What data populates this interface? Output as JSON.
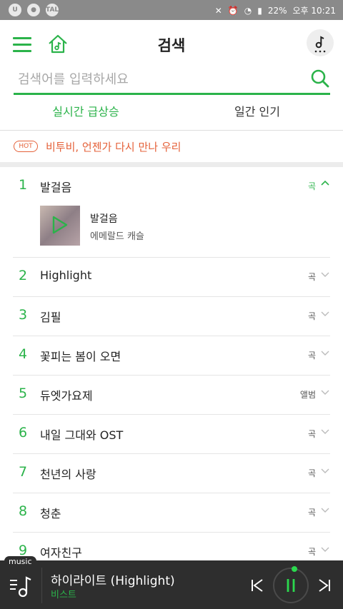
{
  "statusbar": {
    "icons": [
      "u-plus-icon",
      "chat-icon",
      "talk-icon"
    ],
    "battery": "22%",
    "time": "오후 10:21"
  },
  "header": {
    "title": "검색"
  },
  "search": {
    "placeholder": "검색어를 입력하세요",
    "value": ""
  },
  "tabs": [
    {
      "label": "실시간 급상승",
      "active": true
    },
    {
      "label": "일간 인기",
      "active": false
    }
  ],
  "hot": {
    "badge": "HOT",
    "text": "비투비, 언젠가 다시 만나 우리"
  },
  "ranking": [
    {
      "rank": "1",
      "keyword": "발걸음",
      "category": "곡",
      "expanded": true,
      "detail": {
        "title": "발걸음",
        "artist": "에메랄드 캐슬"
      }
    },
    {
      "rank": "2",
      "keyword": "Highlight",
      "category": "곡"
    },
    {
      "rank": "3",
      "keyword": "김필",
      "category": "곡"
    },
    {
      "rank": "4",
      "keyword": "꽃피는 봄이 오면",
      "category": "곡"
    },
    {
      "rank": "5",
      "keyword": "듀엣가요제",
      "category": "앨범"
    },
    {
      "rank": "6",
      "keyword": "내일 그대와 OST",
      "category": "곡"
    },
    {
      "rank": "7",
      "keyword": "천년의 사랑",
      "category": "곡"
    },
    {
      "rank": "8",
      "keyword": "청춘",
      "category": "곡"
    },
    {
      "rank": "9",
      "keyword": "여자친구",
      "category": "곡"
    }
  ],
  "player": {
    "badge": "music",
    "title": "하이라이트 (Highlight)",
    "artist": "비스트"
  },
  "colors": {
    "accent": "#2bb34a",
    "hot": "#e5623a",
    "player_bg": "#2e2e2e"
  }
}
